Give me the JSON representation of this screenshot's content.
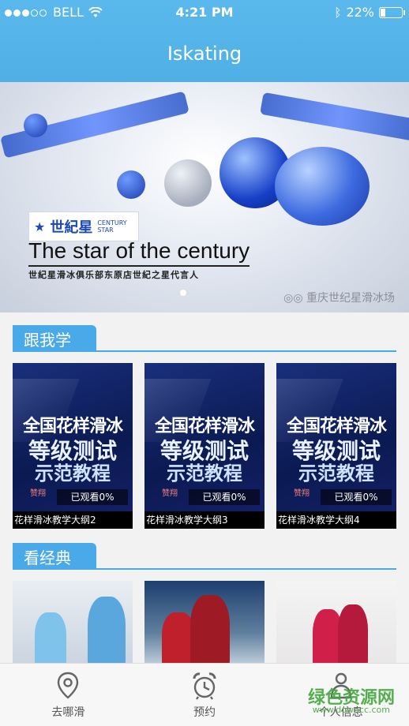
{
  "status_bar": {
    "carrier": "BELL",
    "time": "4:21 PM",
    "battery": "22%",
    "battery_level": 0.22,
    "signal_bars_filled": 3,
    "signal_bars_total": 5
  },
  "header": {
    "title": "Iskating"
  },
  "banner": {
    "logo_cn": "世紀星",
    "logo_en_line1": "CENTURY",
    "logo_en_line2": "STAR",
    "headline": "The star of the century",
    "subtitle": "世紀星滑冰俱乐部东原店世紀之星代言人",
    "watermark": "重庆世纪星滑冰场"
  },
  "sections": [
    {
      "title": "跟我学",
      "cards": [
        {
          "line1": "全国花样滑冰",
          "line2": "等级测试",
          "line3": "示范教程",
          "brand": "赞翔",
          "watched": "已观看0%",
          "caption": "花样滑冰教学大纲2"
        },
        {
          "line1": "全国花样滑冰",
          "line2": "等级测试",
          "line3": "示范教程",
          "brand": "赞翔",
          "watched": "已观看0%",
          "caption": "花样滑冰教学大纲3"
        },
        {
          "line1": "全国花样滑冰",
          "line2": "等级测试",
          "line3": "示范教程",
          "brand": "赞翔",
          "watched": "已观看0%",
          "caption": "花样滑冰教学大纲4"
        }
      ]
    },
    {
      "title": "看经典"
    }
  ],
  "tabbar": [
    {
      "label": "去哪滑",
      "icon": "location-pin-icon"
    },
    {
      "label": "预约",
      "icon": "alarm-clock-icon"
    },
    {
      "label": "个人信息",
      "icon": "person-icon"
    }
  ],
  "watermark": {
    "text": "绿色资源网",
    "url_text": "www.downcc.com"
  },
  "colors": {
    "accent": "#4aa9e8",
    "header": "#5ab8ec"
  }
}
